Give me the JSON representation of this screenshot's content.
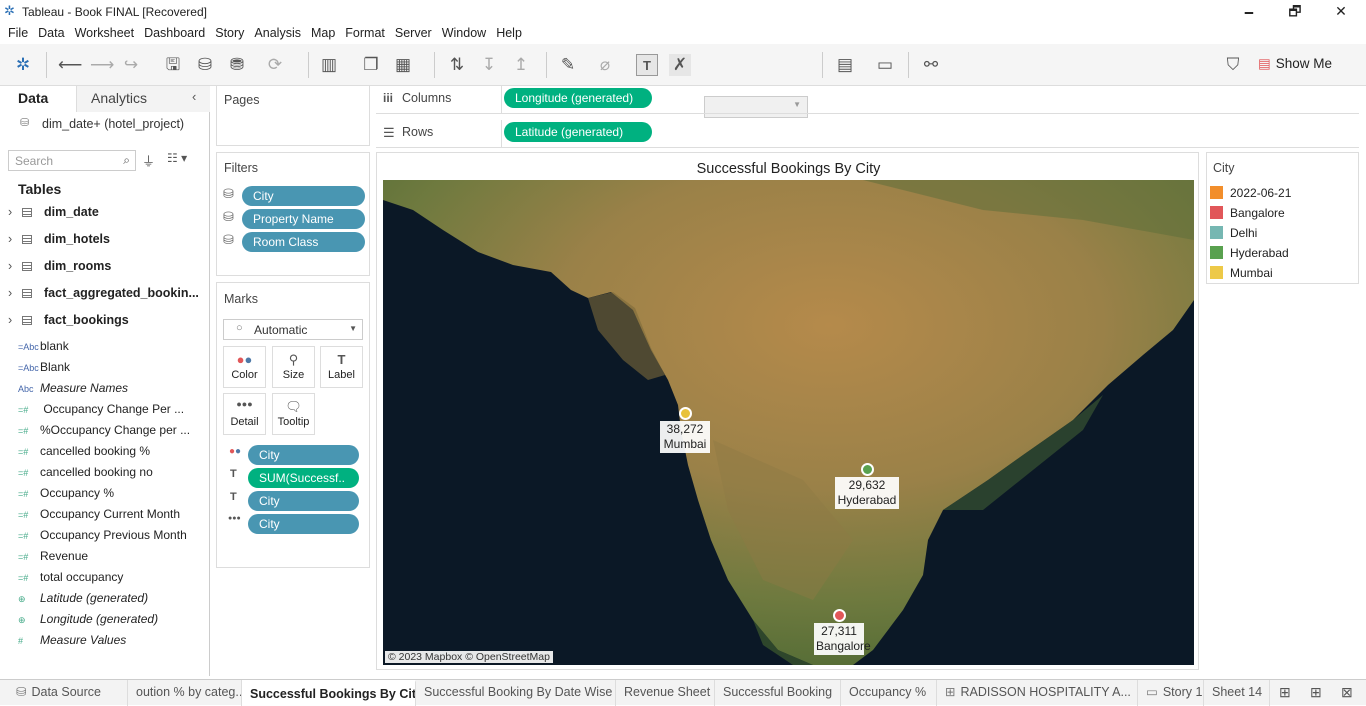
{
  "window": {
    "title": "Tableau - Book  FINAL [Recovered]",
    "minimize": "🗕",
    "restore": "🗗",
    "close": "✕"
  },
  "menu": [
    "File",
    "Data",
    "Worksheet",
    "Dashboard",
    "Story",
    "Analysis",
    "Map",
    "Format",
    "Server",
    "Window",
    "Help"
  ],
  "toolbar": {
    "show_me": "Show Me"
  },
  "left_panel": {
    "tab_data": "Data",
    "tab_analytics": "Analytics",
    "datasource": "dim_date+ (hotel_project)",
    "search_placeholder": "Search",
    "tables_heading": "Tables",
    "tables": [
      "dim_date",
      "dim_hotels",
      "dim_rooms",
      "fact_aggregated_bookin...",
      "fact_bookings"
    ],
    "fields": [
      {
        "type": "=Abc",
        "label": "blank",
        "italic": false
      },
      {
        "type": "=Abc",
        "label": "Blank",
        "italic": false
      },
      {
        "type": "Abc",
        "label": "Measure Names",
        "italic": true
      },
      {
        "type": "=#",
        "label": " Occupancy  Change Per ...",
        "italic": false
      },
      {
        "type": "=#",
        "label": "%Occupancy Change per ...",
        "italic": false
      },
      {
        "type": "=#",
        "label": "cancelled booking %",
        "italic": false
      },
      {
        "type": "=#",
        "label": "cancelled booking no",
        "italic": false
      },
      {
        "type": "=#",
        "label": "Occupancy %",
        "italic": false
      },
      {
        "type": "=#",
        "label": "Occupancy Current Month",
        "italic": false
      },
      {
        "type": "=#",
        "label": "Occupancy Previous Month",
        "italic": false
      },
      {
        "type": "=#",
        "label": "Revenue",
        "italic": false
      },
      {
        "type": "=#",
        "label": "total occupancy",
        "italic": false
      },
      {
        "type": "globe",
        "label": "Latitude (generated)",
        "italic": true
      },
      {
        "type": "globe",
        "label": "Longitude (generated)",
        "italic": true
      },
      {
        "type": "#",
        "label": "Measure Values",
        "italic": true
      }
    ]
  },
  "pages": {
    "title": "Pages"
  },
  "filters": {
    "title": "Filters",
    "items": [
      "City",
      "Property Name",
      "Room Class"
    ]
  },
  "marks": {
    "title": "Marks",
    "type": "Automatic",
    "cards": [
      "Color",
      "Size",
      "Label",
      "Detail",
      "Tooltip"
    ],
    "pills": [
      "City",
      "SUM(Successf..",
      "City",
      "City"
    ]
  },
  "shelves": {
    "columns_label": "Columns",
    "rows_label": "Rows",
    "columns_pill": "Longitude (generated)",
    "rows_pill": "Latitude (generated)"
  },
  "viz": {
    "title": "Successful Bookings By City",
    "attribution": "© 2023 Mapbox © OpenStreetMap"
  },
  "points": [
    {
      "city": "Mumbai",
      "value": "38,272",
      "color": "#e8c23a"
    },
    {
      "city": "Hyderabad",
      "value": "29,632",
      "color": "#59a14f"
    },
    {
      "city": "Bangalore",
      "value": "27,311",
      "color": "#e15759"
    }
  ],
  "legend": {
    "title": "City",
    "items": [
      {
        "label": "2022-06-21",
        "color": "#f28e2b"
      },
      {
        "label": "Bangalore",
        "color": "#e15759"
      },
      {
        "label": "Delhi",
        "color": "#76b7b2"
      },
      {
        "label": "Hyderabad",
        "color": "#59a14f"
      },
      {
        "label": "Mumbai",
        "color": "#edc948"
      }
    ]
  },
  "sheet_tabs": [
    "Data Source",
    "oution % by categ...",
    "Successful Bookings By City",
    "Successful Booking By Date Wise",
    "Revenue Sheet",
    "Successful Booking",
    "Occupancy %",
    "RADISSON HOSPITALITY A...",
    "Story 1",
    "Sheet 14"
  ]
}
